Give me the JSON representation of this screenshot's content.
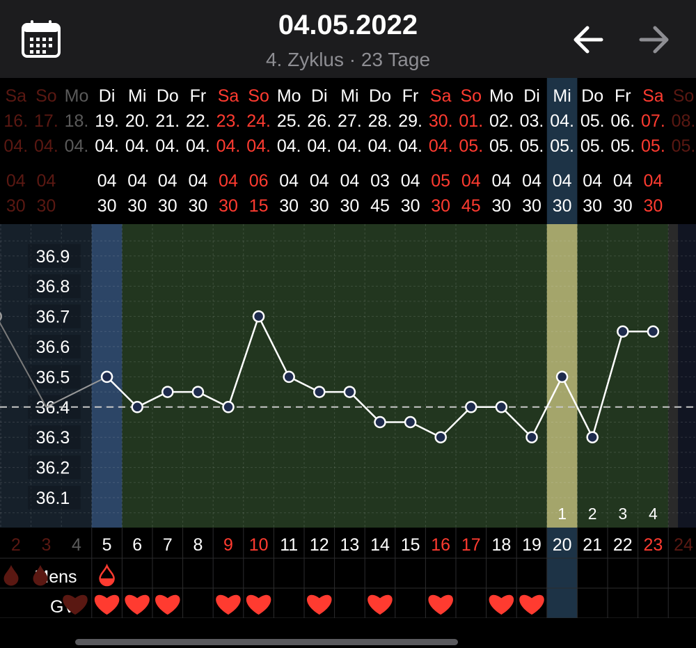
{
  "header": {
    "date": "04.05.2022",
    "subtitle": "4. Zyklus · 23 Tage"
  },
  "colors": {
    "weekend": "#ff3b30",
    "green_band": "#22361f",
    "period_band": "#2c4566",
    "today_band": "#a4a56b",
    "line": "#ffffff",
    "marker_fill": "#1e2b4d"
  },
  "icons": [
    "calendar-icon",
    "arrow-left-icon",
    "arrow-right-icon",
    "blood-drop-icon",
    "heart-icon"
  ],
  "chart_data": {
    "type": "line",
    "y_ticks": [
      "36.9",
      "36.8",
      "36.7",
      "36.6",
      "36.5",
      "36.4",
      "36.3",
      "36.2",
      "36.1"
    ],
    "ylim": [
      36.0,
      37.0
    ],
    "coverline": 36.4,
    "grid": true,
    "columns": [
      {
        "wd": "Sa",
        "d": "16.",
        "m": "04.",
        "t1": "04",
        "t2": "30",
        "cd": "2",
        "temp": null
      },
      {
        "wd": "So",
        "d": "17.",
        "m": "04.",
        "t1": "04",
        "t2": "30",
        "cd": "3",
        "temp": 36.4
      },
      {
        "wd": "Mo",
        "d": "18.",
        "m": "04.",
        "t1": "",
        "t2": "",
        "cd": "4",
        "temp": null
      },
      {
        "wd": "Di",
        "d": "19.",
        "m": "04.",
        "t1": "04",
        "t2": "30",
        "cd": "5",
        "temp": 36.5
      },
      {
        "wd": "Mi",
        "d": "20.",
        "m": "04.",
        "t1": "04",
        "t2": "30",
        "cd": "6",
        "temp": 36.4
      },
      {
        "wd": "Do",
        "d": "21.",
        "m": "04.",
        "t1": "04",
        "t2": "30",
        "cd": "7",
        "temp": 36.45
      },
      {
        "wd": "Fr",
        "d": "22.",
        "m": "04.",
        "t1": "04",
        "t2": "30",
        "cd": "8",
        "temp": 36.45
      },
      {
        "wd": "Sa",
        "d": "23.",
        "m": "04.",
        "t1": "04",
        "t2": "30",
        "cd": "9",
        "temp": 36.4
      },
      {
        "wd": "So",
        "d": "24.",
        "m": "04.",
        "t1": "06",
        "t2": "15",
        "cd": "10",
        "temp": 36.7
      },
      {
        "wd": "Mo",
        "d": "25.",
        "m": "04.",
        "t1": "04",
        "t2": "30",
        "cd": "11",
        "temp": 36.5
      },
      {
        "wd": "Di",
        "d": "26.",
        "m": "04.",
        "t1": "04",
        "t2": "30",
        "cd": "12",
        "temp": 36.45
      },
      {
        "wd": "Mi",
        "d": "27.",
        "m": "04.",
        "t1": "04",
        "t2": "30",
        "cd": "13",
        "temp": 36.45
      },
      {
        "wd": "Do",
        "d": "28.",
        "m": "04.",
        "t1": "03",
        "t2": "45",
        "cd": "14",
        "temp": 36.35
      },
      {
        "wd": "Fr",
        "d": "29.",
        "m": "04.",
        "t1": "04",
        "t2": "30",
        "cd": "15",
        "temp": 36.35
      },
      {
        "wd": "Sa",
        "d": "30.",
        "m": "04.",
        "t1": "05",
        "t2": "30",
        "cd": "16",
        "temp": 36.3
      },
      {
        "wd": "So",
        "d": "01.",
        "m": "05.",
        "t1": "04",
        "t2": "45",
        "cd": "17",
        "temp": 36.4
      },
      {
        "wd": "Mo",
        "d": "02.",
        "m": "05.",
        "t1": "04",
        "t2": "30",
        "cd": "18",
        "temp": 36.4
      },
      {
        "wd": "Di",
        "d": "03.",
        "m": "05.",
        "t1": "04",
        "t2": "30",
        "cd": "19",
        "temp": 36.3
      },
      {
        "wd": "Mi",
        "d": "04.",
        "m": "05.",
        "t1": "04",
        "t2": "30",
        "cd": "20",
        "temp": 36.5
      },
      {
        "wd": "Do",
        "d": "05.",
        "m": "05.",
        "t1": "04",
        "t2": "30",
        "cd": "21",
        "temp": 36.3
      },
      {
        "wd": "Fr",
        "d": "06.",
        "m": "05.",
        "t1": "04",
        "t2": "30",
        "cd": "22",
        "temp": 36.65
      },
      {
        "wd": "Sa",
        "d": "07.",
        "m": "05.",
        "t1": "04",
        "t2": "30",
        "cd": "23",
        "temp": 36.65
      },
      {
        "wd": "So",
        "d": "08.",
        "m": "05.",
        "t1": "",
        "t2": "",
        "cd": "24",
        "temp": null
      }
    ],
    "prev_point": {
      "temp": 36.7
    },
    "post_ovulation_labels": [
      "1",
      "2",
      "3",
      "4"
    ],
    "weekend_days": [
      "Sa",
      "So"
    ],
    "mens_label": "Mens",
    "gv_label": "GV",
    "mens_days": [
      "5"
    ],
    "gv_days": [
      "5",
      "6",
      "7",
      "9",
      "10",
      "12",
      "14",
      "16",
      "18",
      "19"
    ],
    "today_day": "20"
  }
}
